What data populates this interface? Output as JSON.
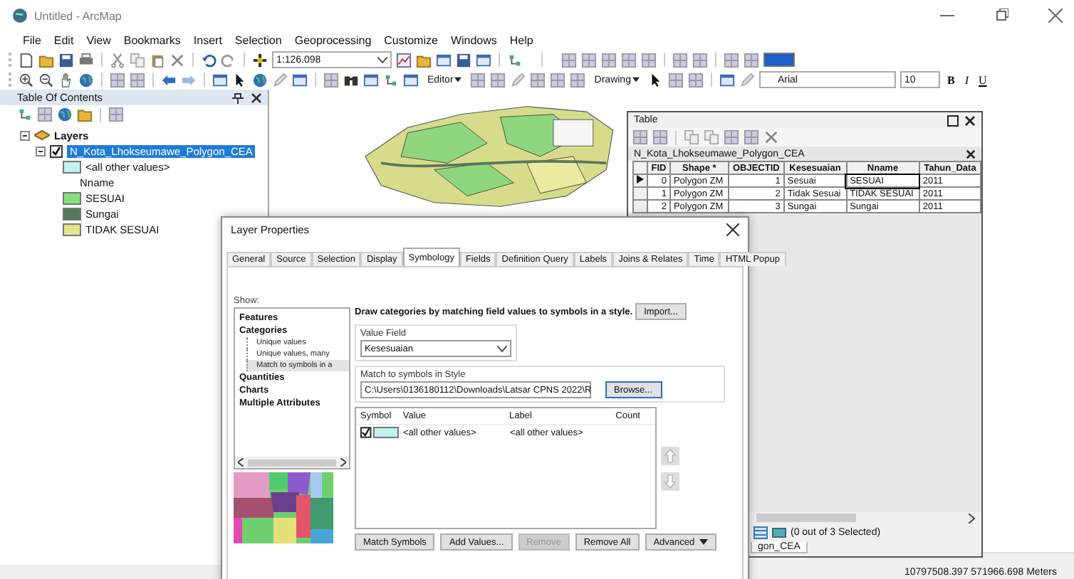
{
  "window": {
    "title": "Untitled - ArcMap"
  },
  "menu": [
    "File",
    "Edit",
    "View",
    "Bookmarks",
    "Insert",
    "Selection",
    "Geoprocessing",
    "Customize",
    "Windows",
    "Help"
  ],
  "toolbar": {
    "scale": "1:126.098",
    "editor": "Editor",
    "drawing": "Drawing",
    "font": "Arial",
    "font_size": "10",
    "bold": "B",
    "italic": "I",
    "underline": "U"
  },
  "toc": {
    "title": "Table Of Contents",
    "root": {
      "label": "Layers",
      "expanded": true,
      "children": [
        {
          "label": "N_Kota_Lhokseumawe_Polygon_CEA",
          "checked": true,
          "selected": true,
          "expanded": true,
          "legend": [
            {
              "kind": "symbol",
              "label": "<all other values>",
              "color": "#bff3ee"
            },
            {
              "kind": "heading",
              "label": "Nname"
            },
            {
              "kind": "symbol",
              "label": "SESUAI",
              "color": "#86e07e"
            },
            {
              "kind": "symbol",
              "label": "Sungai",
              "color": "#56785a"
            },
            {
              "kind": "symbol",
              "label": "TIDAK SESUAI",
              "color": "#e4e38e"
            }
          ]
        }
      ]
    }
  },
  "table_window": {
    "title": "Table",
    "layer_tab": "N_Kota_Lhokseumawe_Polygon_CEA",
    "columns": [
      "FID",
      "Shape *",
      "OBJECTID",
      "Kesesuaian",
      "Nname",
      "Tahun_Data"
    ],
    "rows": [
      {
        "current": true,
        "cells": [
          "0",
          "Polygon ZM",
          "1",
          "Sesuai",
          "SESUAI",
          "2011"
        ]
      },
      {
        "current": false,
        "cells": [
          "1",
          "Polygon ZM",
          "2",
          "Tidak Sesuai",
          "TIDAK SESUAI",
          "2011"
        ]
      },
      {
        "current": false,
        "cells": [
          "2",
          "Polygon ZM",
          "3",
          "Sungai",
          "Sungai",
          "2011"
        ]
      }
    ],
    "selection_status": "(0 out of 3 Selected)",
    "bottom_tab": "gon_CEA"
  },
  "dialog": {
    "title": "Layer Properties",
    "tabs": [
      {
        "label": "General",
        "selected": false
      },
      {
        "label": "Source",
        "selected": false
      },
      {
        "label": "Selection",
        "selected": false
      },
      {
        "label": "Display",
        "selected": false
      },
      {
        "label": "Symbology",
        "selected": true
      },
      {
        "label": "Fields",
        "selected": false
      },
      {
        "label": "Definition Query",
        "selected": false
      },
      {
        "label": "Labels",
        "selected": false
      },
      {
        "label": "Joins & Relates",
        "selected": false
      },
      {
        "label": "Time",
        "selected": false
      },
      {
        "label": "HTML Popup",
        "selected": false
      }
    ],
    "show_label": "Show:",
    "show_items": [
      {
        "label": "Features",
        "selected": false
      },
      {
        "label": "Categories",
        "selected": false,
        "children": [
          {
            "label": "Unique values",
            "selected": false
          },
          {
            "label": "Unique values, many",
            "selected": false
          },
          {
            "label": "Match to symbols in a",
            "selected": true
          }
        ]
      },
      {
        "label": "Quantities",
        "selected": false
      },
      {
        "label": "Charts",
        "selected": false
      },
      {
        "label": "Multiple Attributes",
        "selected": false
      }
    ],
    "heading": "Draw categories by matching field values to symbols in a style.",
    "import_button": "Import...",
    "value_field": {
      "label": "Value Field",
      "value": "Kesesuaian"
    },
    "style": {
      "label": "Match to symbols in Style",
      "value": "C:\\Users\\0136180112\\Downloads\\Latsar CPNS 2022\\R",
      "button": "Browse..."
    },
    "symbol_columns": [
      "Symbol",
      "Value",
      "Label",
      "Count"
    ],
    "symbol_rows": [
      {
        "checked": true,
        "color": "#bff3ee",
        "value": "<all other values>",
        "label": "<all other values>"
      }
    ],
    "buttons": [
      {
        "label": "Match Symbols",
        "disabled": false,
        "dropdown": false
      },
      {
        "label": "Add Values...",
        "disabled": false,
        "dropdown": false
      },
      {
        "label": "Remove",
        "disabled": true,
        "dropdown": false
      },
      {
        "label": "Remove All",
        "disabled": false,
        "dropdown": false
      },
      {
        "label": "Advanced",
        "disabled": false,
        "dropdown": true
      }
    ]
  },
  "status_bar": {
    "coordinates": "10797508.397  571966.698 Meters"
  }
}
